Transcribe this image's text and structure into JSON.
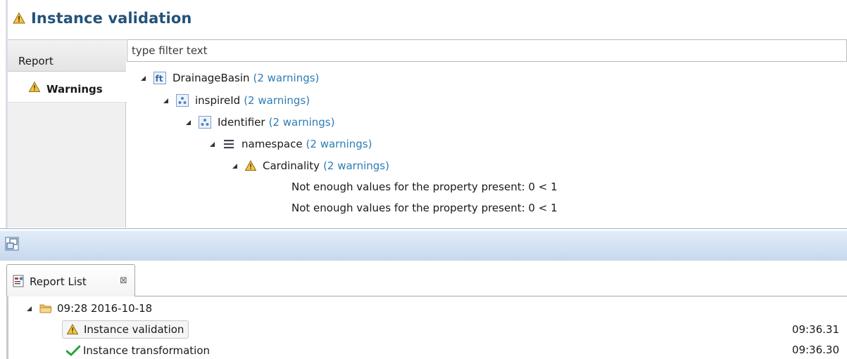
{
  "header": {
    "title": "Instance validation",
    "icon": "warning-icon"
  },
  "sidebar": {
    "tabs": [
      {
        "label": "Report",
        "icon": null
      },
      {
        "label": "Warnings",
        "icon": "warning-icon"
      }
    ]
  },
  "filter": {
    "placeholder": "type filter text",
    "value": ""
  },
  "tree": {
    "nodes": [
      {
        "label": "DrainageBasin",
        "count": "(2 warnings)",
        "icon": "feature-type-icon"
      },
      {
        "label": "inspireId",
        "count": "(2 warnings)",
        "icon": "complex-type-icon"
      },
      {
        "label": "Identifier",
        "count": "(2 warnings)",
        "icon": "complex-type-icon"
      },
      {
        "label": "namespace",
        "count": "(2 warnings)",
        "icon": "property-list-icon"
      },
      {
        "label": "Cardinality",
        "count": "(2 warnings)",
        "icon": "warning-icon"
      }
    ],
    "messages": [
      "Not enough values for the property present: 0 < 1",
      "Not enough values for the property present: 0 < 1"
    ]
  },
  "report_list": {
    "tab_label": "Report List",
    "tab_close": "⊠",
    "group": {
      "label": "09:28 2016-10-18",
      "icon": "folder-icon"
    },
    "items": [
      {
        "label": "Instance validation",
        "time": "09:36.31",
        "icon": "warning-icon"
      },
      {
        "label": "Instance transformation",
        "time": "09:36.30",
        "icon": "check-icon"
      }
    ]
  },
  "colors": {
    "accent": "#24527a",
    "count": "#2c7db5",
    "warning": "#f2b705",
    "success": "#22a33a"
  }
}
